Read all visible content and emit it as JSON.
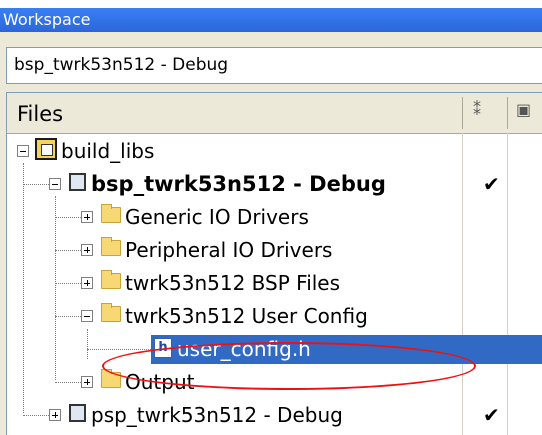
{
  "window": {
    "title": "Workspace"
  },
  "config_select": {
    "value": "bsp_twrk53n512 - Debug"
  },
  "columns": {
    "files": "Files"
  },
  "tree": [
    {
      "label": "build_libs",
      "check": ""
    },
    {
      "label": "bsp_twrk53n512 - Debug",
      "check": "✔"
    },
    {
      "label": "Generic IO Drivers",
      "check": ""
    },
    {
      "label": "Peripheral IO Drivers",
      "check": ""
    },
    {
      "label": "twrk53n512 BSP Files",
      "check": ""
    },
    {
      "label": "twrk53n512 User Config",
      "check": ""
    },
    {
      "label": "user_config.h",
      "check": ""
    },
    {
      "label": "Output",
      "check": ""
    },
    {
      "label": "psp_twrk53n512 - Debug",
      "check": "✔"
    }
  ],
  "icons": {
    "root": "workspace-icon",
    "project": "project-cube-icon",
    "folder": "folder-icon",
    "header_file": "header-file-icon"
  },
  "colors": {
    "selection": "#316ac5",
    "annotation": "#e11111",
    "titlebar": "#2a66da"
  }
}
